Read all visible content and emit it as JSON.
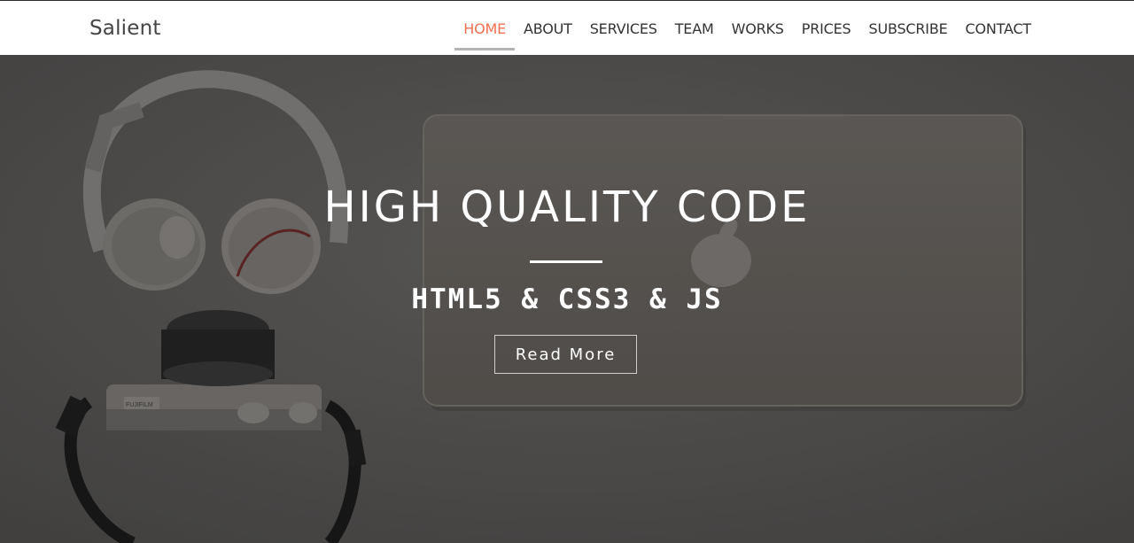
{
  "brand": {
    "name": "Salient"
  },
  "nav": {
    "items": [
      {
        "label": "HOME",
        "active": true
      },
      {
        "label": "ABOUT"
      },
      {
        "label": "SERVICES"
      },
      {
        "label": "TEAM"
      },
      {
        "label": "WORKS"
      },
      {
        "label": "PRICES"
      },
      {
        "label": "SUBSCRIBE"
      },
      {
        "label": "CONTACT"
      }
    ],
    "accent_color": "#f36f51"
  },
  "hero": {
    "title": "HIGH QUALITY CODE",
    "subtitle": "HTML5 & CSS3 & JS",
    "button_label": "Read More",
    "background_description_icons": [
      "headphones-icon",
      "laptop-icon",
      "camera-icon"
    ],
    "camera_brand_text": "FUJIFILM"
  }
}
